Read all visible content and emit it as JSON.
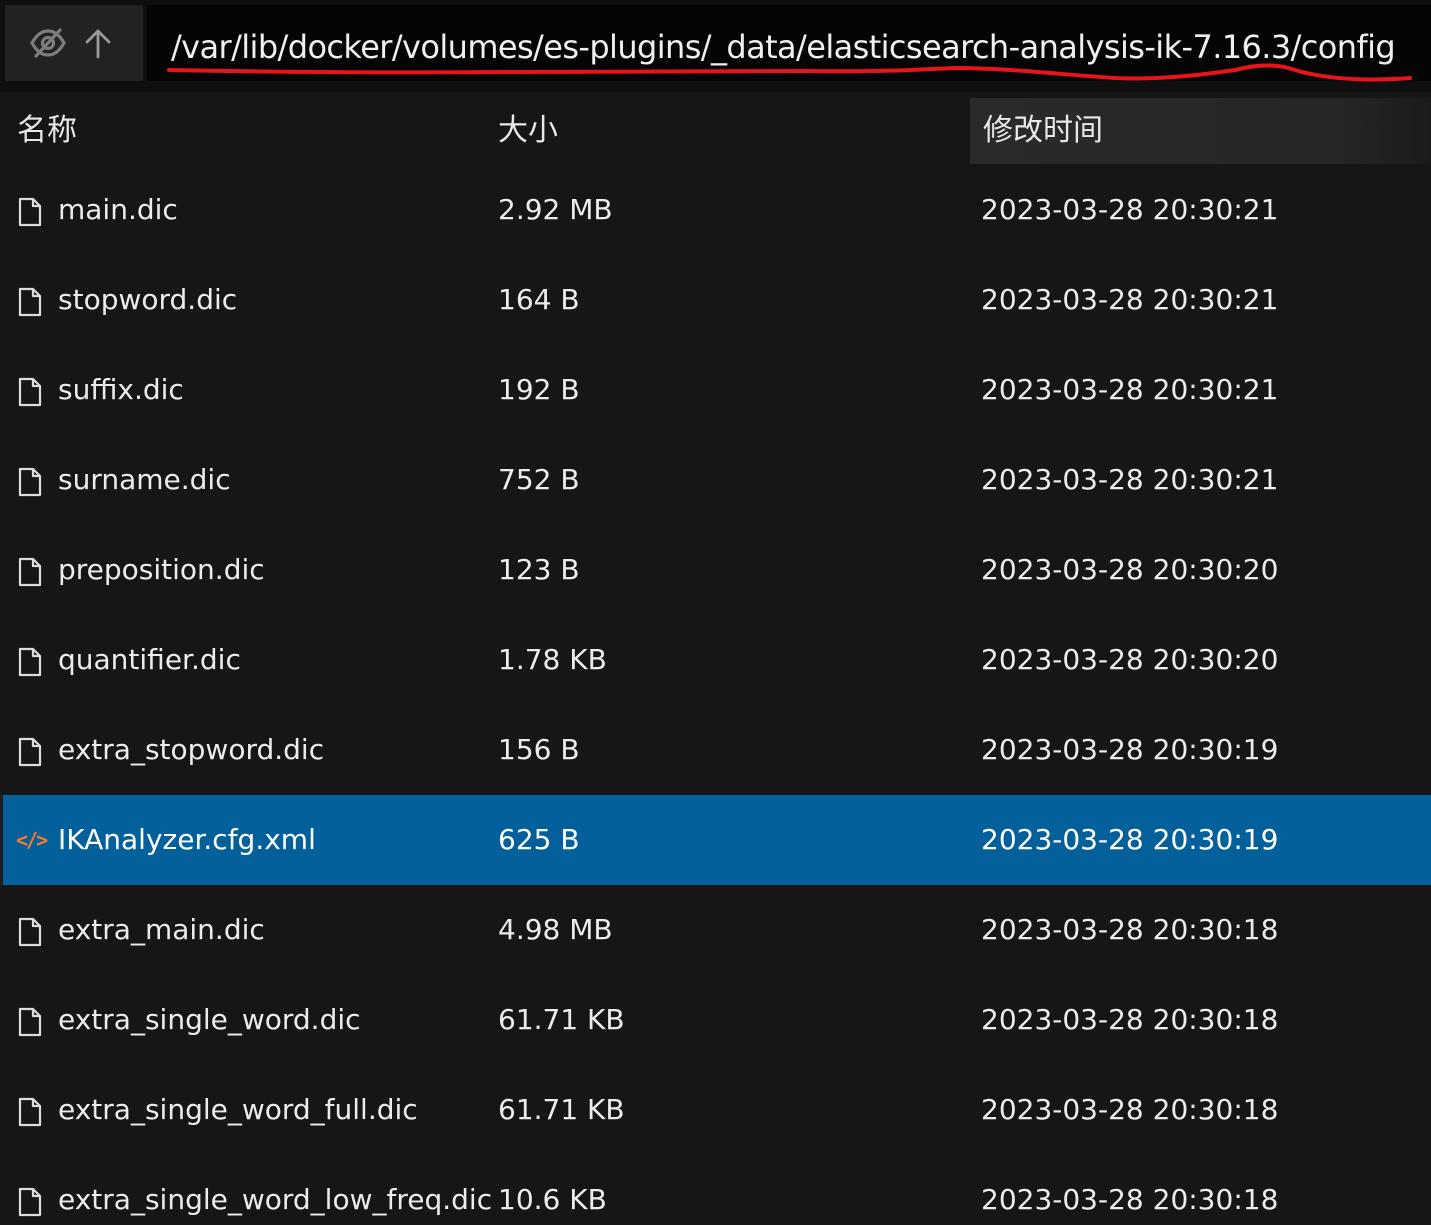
{
  "toolbar": {
    "hide_icon": "eye-off-icon",
    "up_icon": "arrow-up-icon",
    "path": "/var/lib/docker/volumes/es-plugins/_data/elasticsearch-analysis-ik-7.16.3/config"
  },
  "columns": {
    "name": "名称",
    "size": "大小",
    "modified": "修改时间"
  },
  "files": [
    {
      "name": "main.dic",
      "size": "2.92 MB",
      "modified": "2023-03-28 20:30:21",
      "icon": "file-icon"
    },
    {
      "name": "stopword.dic",
      "size": "164 B",
      "modified": "2023-03-28 20:30:21",
      "icon": "file-icon"
    },
    {
      "name": "suffix.dic",
      "size": "192 B",
      "modified": "2023-03-28 20:30:21",
      "icon": "file-icon"
    },
    {
      "name": "surname.dic",
      "size": "752 B",
      "modified": "2023-03-28 20:30:21",
      "icon": "file-icon"
    },
    {
      "name": "preposition.dic",
      "size": "123 B",
      "modified": "2023-03-28 20:30:20",
      "icon": "file-icon"
    },
    {
      "name": "quantifier.dic",
      "size": "1.78 KB",
      "modified": "2023-03-28 20:30:20",
      "icon": "file-icon"
    },
    {
      "name": "extra_stopword.dic",
      "size": "156 B",
      "modified": "2023-03-28 20:30:19",
      "icon": "file-icon"
    },
    {
      "name": "IKAnalyzer.cfg.xml",
      "size": "625 B",
      "modified": "2023-03-28 20:30:19",
      "icon": "xml-code-icon",
      "selected": true
    },
    {
      "name": "extra_main.dic",
      "size": "4.98 MB",
      "modified": "2023-03-28 20:30:18",
      "icon": "file-icon"
    },
    {
      "name": "extra_single_word.dic",
      "size": "61.71 KB",
      "modified": "2023-03-28 20:30:18",
      "icon": "file-icon"
    },
    {
      "name": "extra_single_word_full.dic",
      "size": "61.71 KB",
      "modified": "2023-03-28 20:30:18",
      "icon": "file-icon"
    },
    {
      "name": "extra_single_word_low_freq.dic",
      "size": "10.6 KB",
      "modified": "2023-03-28 20:30:18",
      "icon": "file-icon"
    }
  ],
  "colors": {
    "background": "#161616",
    "selected_row": "#03609a",
    "xml_icon": "#ff7a2a",
    "annotation_underline": "#e8141a"
  }
}
